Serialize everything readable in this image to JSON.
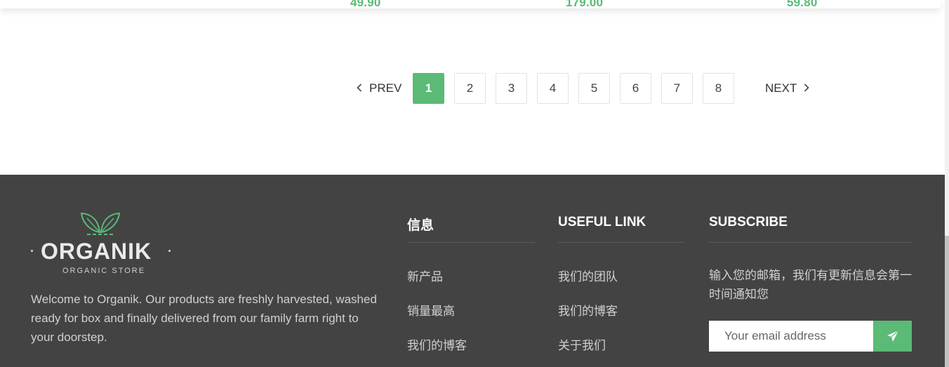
{
  "products": {
    "prices": [
      "49.90",
      "179.00",
      "59.80"
    ]
  },
  "pagination": {
    "prev_label": "PREV",
    "next_label": "NEXT",
    "pages": [
      "1",
      "2",
      "3",
      "4",
      "5",
      "6",
      "7",
      "8"
    ],
    "active_page": "1"
  },
  "footer": {
    "logo": {
      "word": "ORGANIK",
      "tagline": "ORGANIC STORE"
    },
    "about": "Welcome to Organik. Our products are freshly harvested, washed ready for box and finally delivered from our family farm right to your doorstep.",
    "info": {
      "title": "信息",
      "links": [
        "新产品",
        "销量最高",
        "我们的博客"
      ]
    },
    "useful": {
      "title": "USEFUL LINK",
      "links": [
        "我们的团队",
        "我们的博客",
        "关于我们"
      ]
    },
    "subscribe": {
      "title": "SUBSCRIBE",
      "text": "输入您的邮箱，我们有更新信息会第一时间通知您",
      "placeholder": "Your email address",
      "button_icon": "paper-plane-icon"
    }
  },
  "colors": {
    "accent": "#5aba76",
    "footer_bg": "#434343"
  }
}
